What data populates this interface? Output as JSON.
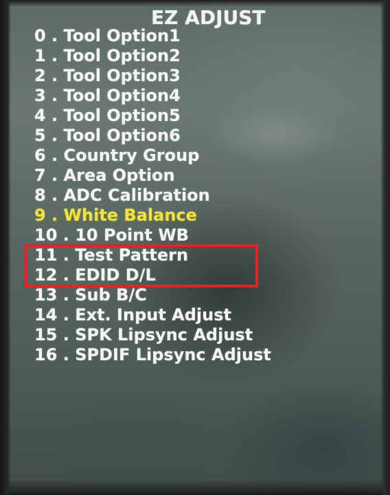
{
  "menu": {
    "title": "EZ ADJUST",
    "items": [
      {
        "label": "0 . Tool Option1"
      },
      {
        "label": "1 . Tool Option2"
      },
      {
        "label": "2 . Tool Option3"
      },
      {
        "label": "3 . Tool Option4"
      },
      {
        "label": "4 . Tool Option5"
      },
      {
        "label": "5 . Tool Option6"
      },
      {
        "label": "6 . Country Group"
      },
      {
        "label": "7 . Area Option"
      },
      {
        "label": "8 . ADC Calibration"
      },
      {
        "label": "9 . White Balance",
        "selected": true
      },
      {
        "label": "10 . 10 Point WB"
      },
      {
        "label": "11 . Test Pattern"
      },
      {
        "label": "12 . EDID D/L"
      },
      {
        "label": "13 . Sub B/C"
      },
      {
        "label": "14 . Ext. Input Adjust"
      },
      {
        "label": "15 . SPK Lipsync Adjust"
      },
      {
        "label": "16 . SPDIF Lipsync Adjust"
      }
    ]
  },
  "colors": {
    "menu_text": "#f4f6f4",
    "selected_text": "#f0e43a",
    "annotation_box": "#e8231f"
  }
}
